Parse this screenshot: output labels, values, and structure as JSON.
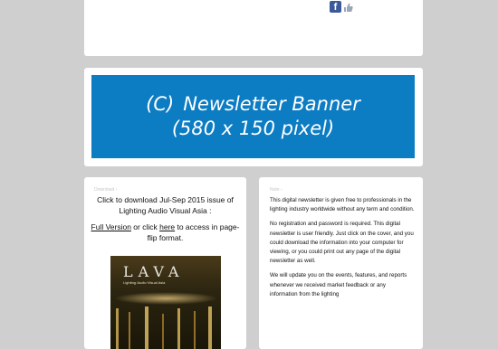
{
  "top": {
    "facebook_glyph": "f",
    "icons": [
      "facebook-icon",
      "like-icon"
    ]
  },
  "banner": {
    "prefix": "(C)",
    "title": "Newsletter Banner",
    "size": "(580 x 150 pixel)",
    "color": "#0c7cc3"
  },
  "left": {
    "heading": "Download ›",
    "line1": "Click to download Jul-Sep 2015 issue of Lighting Audio Visual Asia :",
    "full_version": "Full Version",
    "or_click": " or click ",
    "here": "here",
    "access": " to access in page-flip format.",
    "cover": {
      "logo": "LAVA",
      "subtitle": "Lighting·Audio·Visual Asia"
    }
  },
  "right": {
    "heading": "Note ›",
    "p1": "This digital newsletter is given free to professionals in the lighting industry worldwide without any term and condition.",
    "p2": "No registration and password is required. This digital newsletter is user friendly. Just click on the cover, and you could download the information into your computer for viewing, or you could print out any page of the digital newsletter as well.",
    "p3": "We will update you on the events, features, and reports whenever we received market feedback or any information from the lighting"
  }
}
